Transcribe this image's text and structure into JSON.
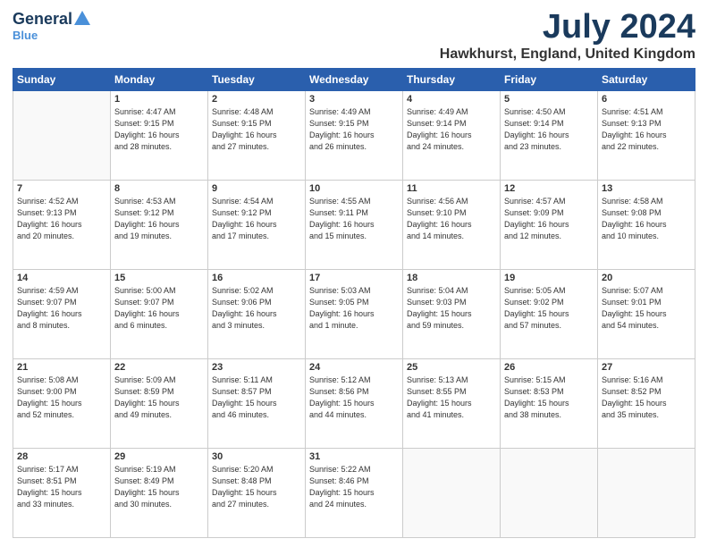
{
  "logo": {
    "general": "General",
    "blue": "Blue"
  },
  "title": "July 2024",
  "location": "Hawkhurst, England, United Kingdom",
  "days_of_week": [
    "Sunday",
    "Monday",
    "Tuesday",
    "Wednesday",
    "Thursday",
    "Friday",
    "Saturday"
  ],
  "weeks": [
    [
      {
        "day": "",
        "info": "",
        "empty": true
      },
      {
        "day": "1",
        "info": "Sunrise: 4:47 AM\nSunset: 9:15 PM\nDaylight: 16 hours\nand 28 minutes."
      },
      {
        "day": "2",
        "info": "Sunrise: 4:48 AM\nSunset: 9:15 PM\nDaylight: 16 hours\nand 27 minutes."
      },
      {
        "day": "3",
        "info": "Sunrise: 4:49 AM\nSunset: 9:15 PM\nDaylight: 16 hours\nand 26 minutes."
      },
      {
        "day": "4",
        "info": "Sunrise: 4:49 AM\nSunset: 9:14 PM\nDaylight: 16 hours\nand 24 minutes."
      },
      {
        "day": "5",
        "info": "Sunrise: 4:50 AM\nSunset: 9:14 PM\nDaylight: 16 hours\nand 23 minutes."
      },
      {
        "day": "6",
        "info": "Sunrise: 4:51 AM\nSunset: 9:13 PM\nDaylight: 16 hours\nand 22 minutes."
      }
    ],
    [
      {
        "day": "7",
        "info": "Sunrise: 4:52 AM\nSunset: 9:13 PM\nDaylight: 16 hours\nand 20 minutes."
      },
      {
        "day": "8",
        "info": "Sunrise: 4:53 AM\nSunset: 9:12 PM\nDaylight: 16 hours\nand 19 minutes."
      },
      {
        "day": "9",
        "info": "Sunrise: 4:54 AM\nSunset: 9:12 PM\nDaylight: 16 hours\nand 17 minutes."
      },
      {
        "day": "10",
        "info": "Sunrise: 4:55 AM\nSunset: 9:11 PM\nDaylight: 16 hours\nand 15 minutes."
      },
      {
        "day": "11",
        "info": "Sunrise: 4:56 AM\nSunset: 9:10 PM\nDaylight: 16 hours\nand 14 minutes."
      },
      {
        "day": "12",
        "info": "Sunrise: 4:57 AM\nSunset: 9:09 PM\nDaylight: 16 hours\nand 12 minutes."
      },
      {
        "day": "13",
        "info": "Sunrise: 4:58 AM\nSunset: 9:08 PM\nDaylight: 16 hours\nand 10 minutes."
      }
    ],
    [
      {
        "day": "14",
        "info": "Sunrise: 4:59 AM\nSunset: 9:07 PM\nDaylight: 16 hours\nand 8 minutes."
      },
      {
        "day": "15",
        "info": "Sunrise: 5:00 AM\nSunset: 9:07 PM\nDaylight: 16 hours\nand 6 minutes."
      },
      {
        "day": "16",
        "info": "Sunrise: 5:02 AM\nSunset: 9:06 PM\nDaylight: 16 hours\nand 3 minutes."
      },
      {
        "day": "17",
        "info": "Sunrise: 5:03 AM\nSunset: 9:05 PM\nDaylight: 16 hours\nand 1 minute."
      },
      {
        "day": "18",
        "info": "Sunrise: 5:04 AM\nSunset: 9:03 PM\nDaylight: 15 hours\nand 59 minutes."
      },
      {
        "day": "19",
        "info": "Sunrise: 5:05 AM\nSunset: 9:02 PM\nDaylight: 15 hours\nand 57 minutes."
      },
      {
        "day": "20",
        "info": "Sunrise: 5:07 AM\nSunset: 9:01 PM\nDaylight: 15 hours\nand 54 minutes."
      }
    ],
    [
      {
        "day": "21",
        "info": "Sunrise: 5:08 AM\nSunset: 9:00 PM\nDaylight: 15 hours\nand 52 minutes."
      },
      {
        "day": "22",
        "info": "Sunrise: 5:09 AM\nSunset: 8:59 PM\nDaylight: 15 hours\nand 49 minutes."
      },
      {
        "day": "23",
        "info": "Sunrise: 5:11 AM\nSunset: 8:57 PM\nDaylight: 15 hours\nand 46 minutes."
      },
      {
        "day": "24",
        "info": "Sunrise: 5:12 AM\nSunset: 8:56 PM\nDaylight: 15 hours\nand 44 minutes."
      },
      {
        "day": "25",
        "info": "Sunrise: 5:13 AM\nSunset: 8:55 PM\nDaylight: 15 hours\nand 41 minutes."
      },
      {
        "day": "26",
        "info": "Sunrise: 5:15 AM\nSunset: 8:53 PM\nDaylight: 15 hours\nand 38 minutes."
      },
      {
        "day": "27",
        "info": "Sunrise: 5:16 AM\nSunset: 8:52 PM\nDaylight: 15 hours\nand 35 minutes."
      }
    ],
    [
      {
        "day": "28",
        "info": "Sunrise: 5:17 AM\nSunset: 8:51 PM\nDaylight: 15 hours\nand 33 minutes."
      },
      {
        "day": "29",
        "info": "Sunrise: 5:19 AM\nSunset: 8:49 PM\nDaylight: 15 hours\nand 30 minutes."
      },
      {
        "day": "30",
        "info": "Sunrise: 5:20 AM\nSunset: 8:48 PM\nDaylight: 15 hours\nand 27 minutes."
      },
      {
        "day": "31",
        "info": "Sunrise: 5:22 AM\nSunset: 8:46 PM\nDaylight: 15 hours\nand 24 minutes."
      },
      {
        "day": "",
        "info": "",
        "empty": true
      },
      {
        "day": "",
        "info": "",
        "empty": true
      },
      {
        "day": "",
        "info": "",
        "empty": true
      }
    ]
  ]
}
